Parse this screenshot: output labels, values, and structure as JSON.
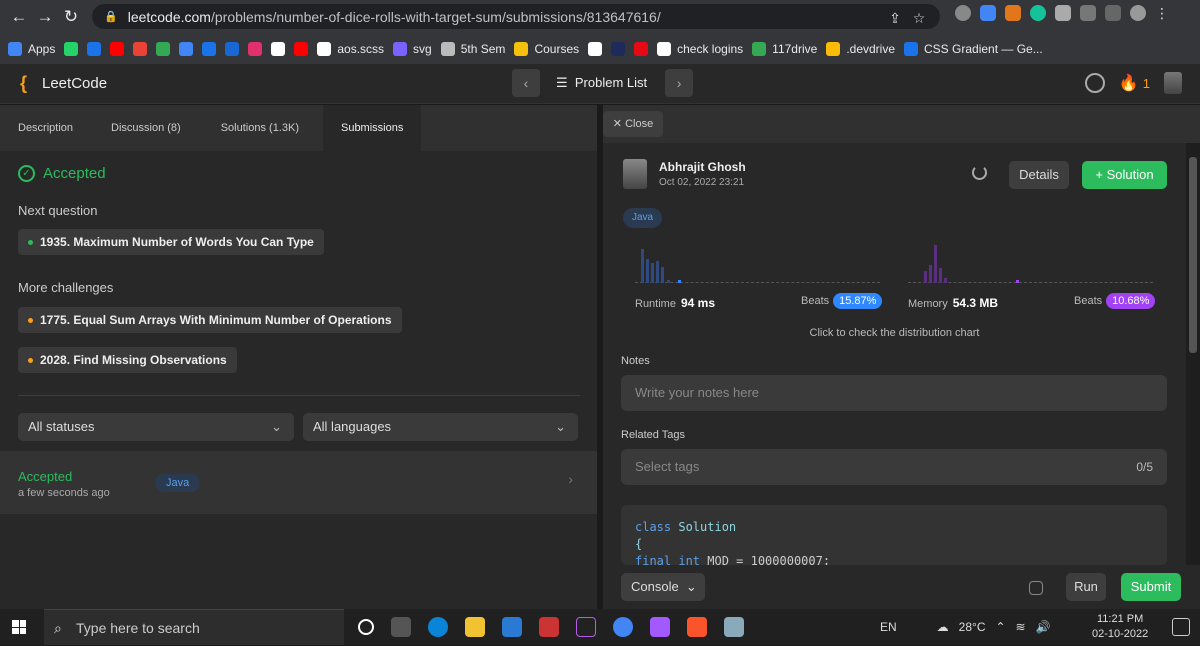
{
  "browser": {
    "url_host": "leetcode.com",
    "url_path": "/problems/number-of-dice-rolls-with-target-sum/submissions/813647616/",
    "bookmarks": [
      {
        "label": "Apps",
        "color": "#4285f4"
      },
      {
        "label": "",
        "color": "#25d366"
      },
      {
        "label": "",
        "color": "#1a73e8"
      },
      {
        "label": "",
        "color": "#ff0000"
      },
      {
        "label": "",
        "color": "#ea4335"
      },
      {
        "label": "",
        "color": "#34a853"
      },
      {
        "label": "",
        "color": "#4285f4"
      },
      {
        "label": "",
        "color": "#1a73e8"
      },
      {
        "label": "",
        "color": "#1967d2"
      },
      {
        "label": "",
        "color": "#e1306c"
      },
      {
        "label": "",
        "color": "#ffffff"
      },
      {
        "label": "",
        "color": "#ff0000"
      },
      {
        "label": "aos.scss",
        "color": "#ffffff"
      },
      {
        "label": "svg",
        "color": "#7b61ff"
      },
      {
        "label": "5th Sem",
        "color": "#bbbbbb"
      },
      {
        "label": "Courses",
        "color": "#f4c20d"
      },
      {
        "label": "",
        "color": "#ffffff"
      },
      {
        "label": "",
        "color": "#1e2a5a"
      },
      {
        "label": "",
        "color": "#e50914"
      },
      {
        "label": "check logins",
        "color": "#ffffff"
      },
      {
        "label": "117drive",
        "color": "#34a853"
      },
      {
        "label": ".devdrive",
        "color": "#fbbc05"
      },
      {
        "label": "CSS Gradient — Ge...",
        "color": "#1a73e8"
      }
    ]
  },
  "nav": {
    "logo": "LeetCode",
    "problem_list": "Problem List",
    "streak": "1"
  },
  "tabs": [
    {
      "label": "Description"
    },
    {
      "label": "Discussion (8)"
    },
    {
      "label": "Solutions (1.3K)"
    },
    {
      "label": "Submissions"
    }
  ],
  "result": {
    "status": "Accepted",
    "next_label": "Next question",
    "next_item": "1935. Maximum Number of Words You Can Type",
    "more_label": "More challenges",
    "challenges": [
      "1775. Equal Sum Arrays With Minimum Number of Operations",
      "2028. Find Missing Observations"
    ]
  },
  "filters": {
    "status": "All statuses",
    "language": "All languages"
  },
  "submission_row": {
    "status": "Accepted",
    "time": "a few seconds ago",
    "language": "Java"
  },
  "detail": {
    "close": "Close",
    "user": "Abhrajit Ghosh",
    "date": "Oct 02, 2022 23:21",
    "details_btn": "Details",
    "solution_btn": "Solution",
    "language": "Java",
    "runtime_label": "Runtime",
    "runtime": "94 ms",
    "beats_label": "Beats",
    "runtime_beats": "15.87%",
    "memory_label": "Memory",
    "memory": "54.3 MB",
    "memory_beats": "10.68%",
    "hint": "Click to check the distribution chart",
    "notes_label": "Notes",
    "notes_placeholder": "Write your notes here",
    "tags_label": "Related Tags",
    "tags_placeholder": "Select tags",
    "tags_count": "0/5",
    "code_lines": [
      "class Solution",
      "{",
      "final int MOD = 1000000007;"
    ],
    "console_btn": "Console",
    "run_btn": "Run",
    "submit_btn": "Submit"
  },
  "taskbar": {
    "search_placeholder": "Type here to search",
    "lang": "EN",
    "temp": "28°C",
    "time": "11:21 PM",
    "date": "02-10-2022"
  },
  "colors": {
    "accent_green": "#2cbb5d",
    "runtime_badge": "#2f88ff",
    "memory_badge": "#a142f4",
    "orange": "#f89f1b"
  }
}
